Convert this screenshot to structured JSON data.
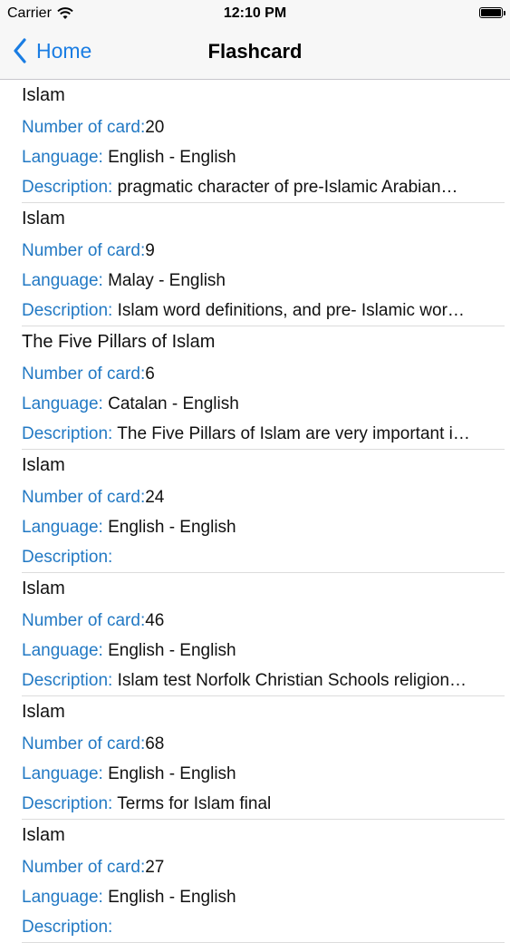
{
  "status_bar": {
    "carrier": "Carrier",
    "time": "12:10 PM"
  },
  "nav": {
    "back_label": "Home",
    "title": "Flashcard"
  },
  "labels": {
    "count": "Number of card:",
    "language": "Language:",
    "description": "Description:"
  },
  "items": [
    {
      "title": "Islam",
      "count": "20",
      "language": "English - English",
      "description": "pragmatic character of pre-Islamic Arabian…"
    },
    {
      "title": "Islam",
      "count": "9",
      "language": "Malay - English",
      "description": "Islam word definitions, and pre- Islamic wor…"
    },
    {
      "title": "The Five Pillars of Islam",
      "count": "6",
      "language": "Catalan - English",
      "description": "The Five Pillars of Islam are very important i…"
    },
    {
      "title": "Islam",
      "count": "24",
      "language": "English - English",
      "description": ""
    },
    {
      "title": "Islam",
      "count": "46",
      "language": "English - English",
      "description": "Islam test Norfolk Christian Schools religion…"
    },
    {
      "title": "Islam",
      "count": "68",
      "language": "English - English",
      "description": "Terms for Islam final"
    },
    {
      "title": "Islam",
      "count": "27",
      "language": "English - English",
      "description": ""
    }
  ]
}
